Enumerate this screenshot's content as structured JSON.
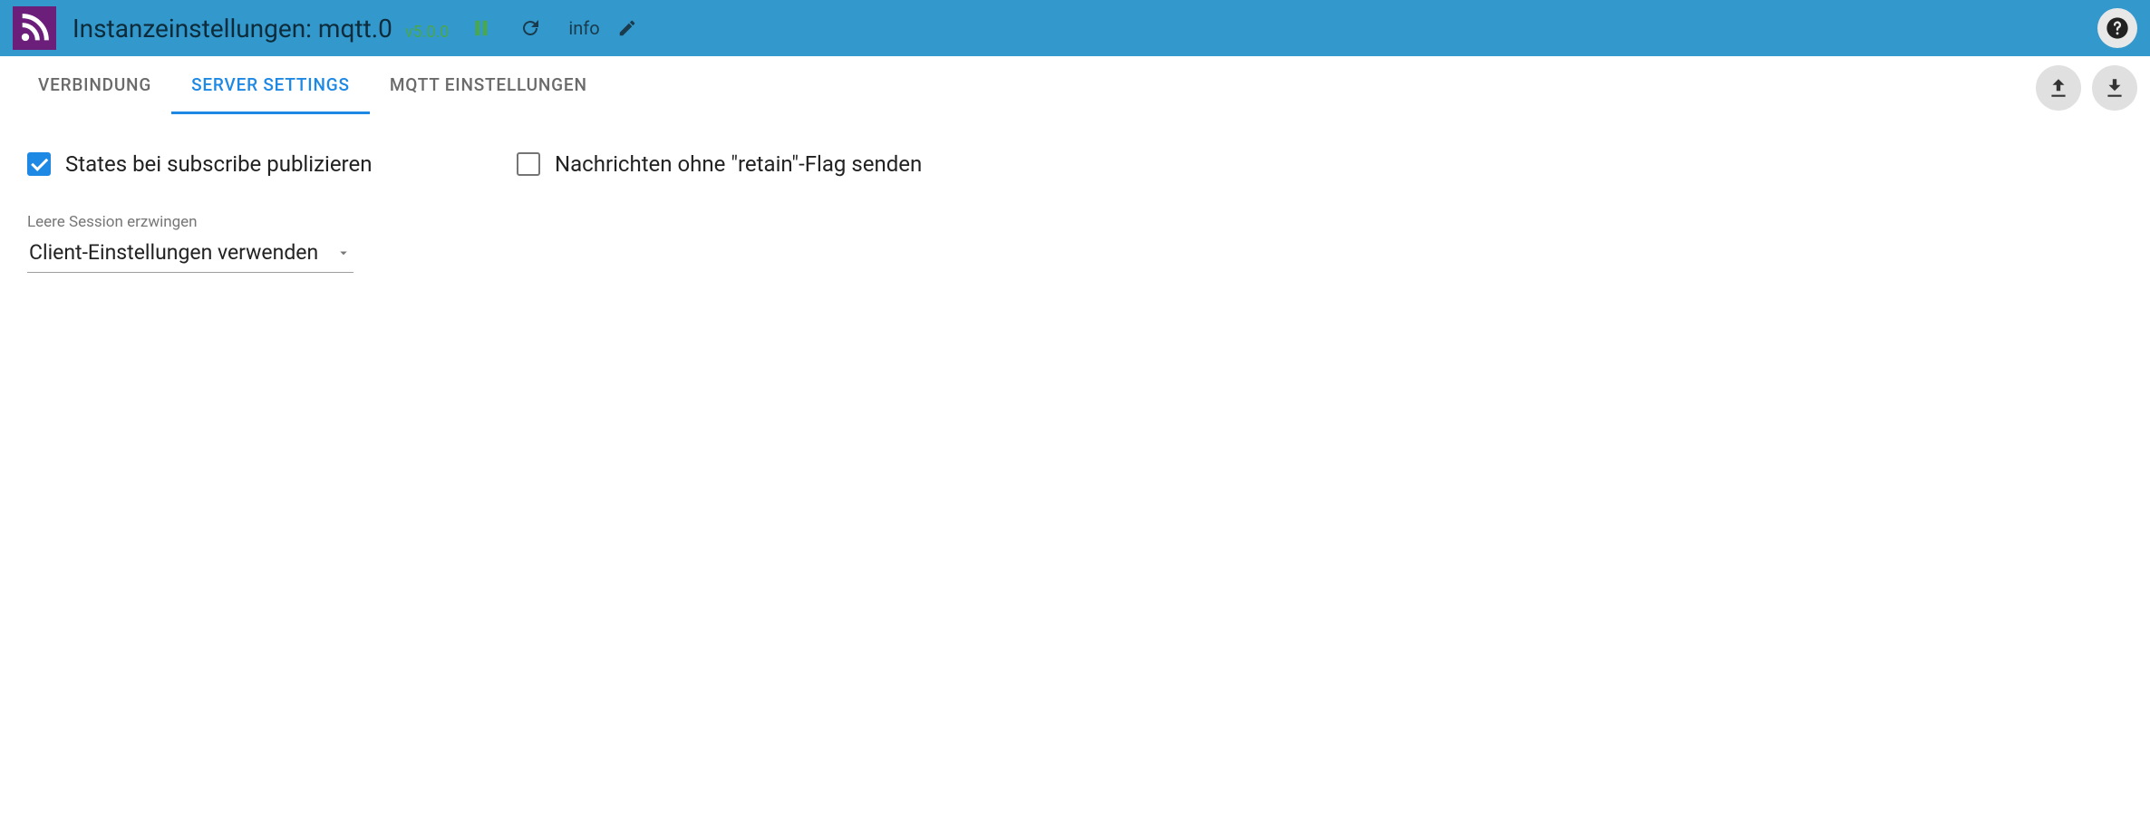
{
  "header": {
    "title": "Instanzeinstellungen: mqtt.0",
    "version": "v5.0.0",
    "info_label": "info"
  },
  "tabs": [
    {
      "label": "Verbindung",
      "active": false
    },
    {
      "label": "Server settings",
      "active": true
    },
    {
      "label": "MQTT Einstellungen",
      "active": false
    }
  ],
  "settings": {
    "publish_on_subscribe": {
      "label": "States bei subscribe publizieren",
      "checked": true
    },
    "no_retain": {
      "label": "Nachrichten ohne \"retain\"-Flag senden",
      "checked": false
    },
    "force_clean_session": {
      "label": "Leere Session erzwingen",
      "value": "Client-Einstellungen verwenden"
    }
  }
}
